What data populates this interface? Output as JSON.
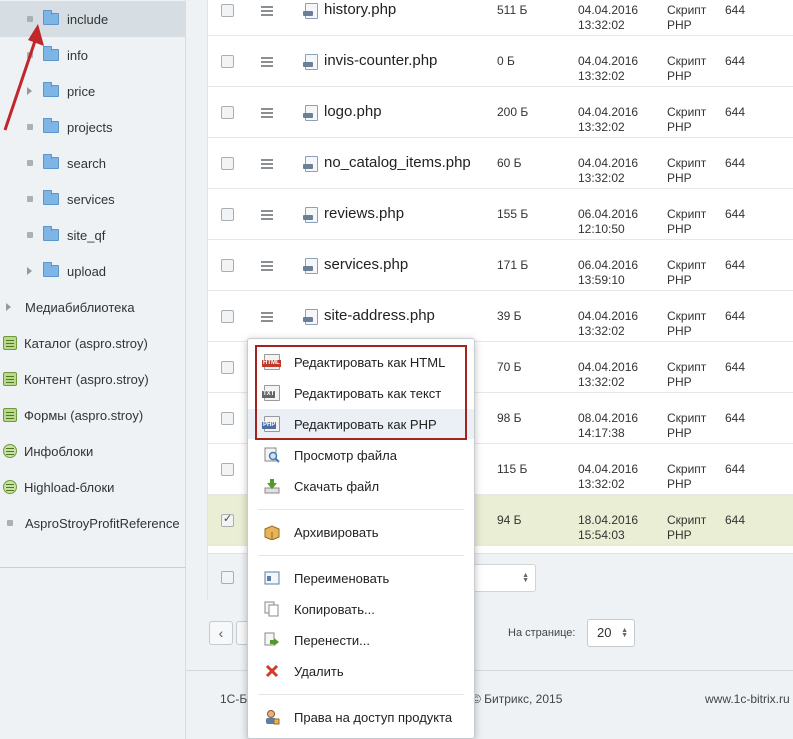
{
  "sidebar": {
    "tree": [
      {
        "label": "include",
        "type": "folder",
        "selected": true
      },
      {
        "label": "info",
        "type": "folder"
      },
      {
        "label": "price",
        "type": "folder",
        "expandable": true
      },
      {
        "label": "projects",
        "type": "folder"
      },
      {
        "label": "search",
        "type": "folder"
      },
      {
        "label": "services",
        "type": "folder"
      },
      {
        "label": "site_qf",
        "type": "folder"
      },
      {
        "label": "upload",
        "type": "folder",
        "expandable": true
      }
    ],
    "modules": [
      {
        "label": "Медиабиблиотека",
        "icon": "expand-arrow-icon"
      },
      {
        "label": "Каталог (aspro.stroy)",
        "icon": "catalog-module-icon"
      },
      {
        "label": "Контент (aspro.stroy)",
        "icon": "content-module-icon"
      },
      {
        "label": "Формы (aspro.stroy)",
        "icon": "forms-module-icon"
      },
      {
        "label": "Инфоблоки",
        "icon": "iblock-gear-icon"
      },
      {
        "label": "Highload-блоки",
        "icon": "highload-gear-icon"
      },
      {
        "label": "AsproStroyProfitReference",
        "icon": "bullet-icon"
      }
    ]
  },
  "files": [
    {
      "name": "history.php",
      "size": "511 Б",
      "date": "04.04.2016",
      "time": "13:32:02",
      "type1": "Скрипт",
      "type2": "PHP",
      "perm": "644"
    },
    {
      "name": "invis-counter.php",
      "size": "0 Б",
      "date": "04.04.2016",
      "time": "13:32:02",
      "type1": "Скрипт",
      "type2": "PHP",
      "perm": "644"
    },
    {
      "name": "logo.php",
      "size": "200 Б",
      "date": "04.04.2016",
      "time": "13:32:02",
      "type1": "Скрипт",
      "type2": "PHP",
      "perm": "644"
    },
    {
      "name": "no_catalog_items.php",
      "size": "60 Б",
      "date": "04.04.2016",
      "time": "13:32:02",
      "type1": "Скрипт",
      "type2": "PHP",
      "perm": "644"
    },
    {
      "name": "reviews.php",
      "size": "155 Б",
      "date": "06.04.2016",
      "time": "12:10:50",
      "type1": "Скрипт",
      "type2": "PHP",
      "perm": "644"
    },
    {
      "name": "services.php",
      "size": "171 Б",
      "date": "06.04.2016",
      "time": "13:59:10",
      "type1": "Скрипт",
      "type2": "PHP",
      "perm": "644"
    },
    {
      "name": "site-address.php",
      "size": "39 Б",
      "date": "04.04.2016",
      "time": "13:32:02",
      "type1": "Скрипт",
      "type2": "PHP",
      "perm": "644"
    },
    {
      "name": "",
      "size": "70 Б",
      "date": "04.04.2016",
      "time": "13:32:02",
      "type1": "Скрипт",
      "type2": "PHP",
      "perm": "644"
    },
    {
      "name": "",
      "size": "98 Б",
      "date": "08.04.2016",
      "time": "14:17:38",
      "type1": "Скрипт",
      "type2": "PHP",
      "perm": "644"
    },
    {
      "name": "",
      "size": "115 Б",
      "date": "04.04.2016",
      "time": "13:32:02",
      "type1": "Скрипт",
      "type2": "PHP",
      "perm": "644"
    },
    {
      "name": "",
      "size": "94 Б",
      "date": "18.04.2016",
      "time": "15:54:03",
      "type1": "Скрипт",
      "type2": "PHP",
      "perm": "644",
      "checked": true
    }
  ],
  "pagination": {
    "prev": "‹",
    "per_page_label": "На странице:",
    "per_page_value": "20"
  },
  "footer": {
    "left": "1С-Б",
    "copyright": "© Битрикс, 2015",
    "site": "www.1c-bitrix.ru"
  },
  "context_menu": {
    "items": [
      {
        "label": "Редактировать как HTML",
        "icon": "html-file-icon"
      },
      {
        "label": "Редактировать как текст",
        "icon": "txt-file-icon"
      },
      {
        "label": "Редактировать как PHP",
        "icon": "php-file-icon"
      },
      {
        "label": "Просмотр файла",
        "icon": "view-file-icon"
      },
      {
        "label": "Скачать файл",
        "icon": "download-icon"
      },
      {
        "label": "Архивировать",
        "icon": "archive-box-icon"
      },
      {
        "label": "Переименовать",
        "icon": "rename-icon"
      },
      {
        "label": "Копировать...",
        "icon": "copy-icon"
      },
      {
        "label": "Перенести...",
        "icon": "move-icon"
      },
      {
        "label": "Удалить",
        "icon": "delete-x-icon"
      },
      {
        "label": "Права на доступ продукта",
        "icon": "access-rights-icon"
      }
    ],
    "highlight_color": "#a4231f"
  },
  "colors": {
    "accent_red": "#c0262a",
    "selected_row": "#e9eed4",
    "folder_blue": "#7db5e6"
  }
}
